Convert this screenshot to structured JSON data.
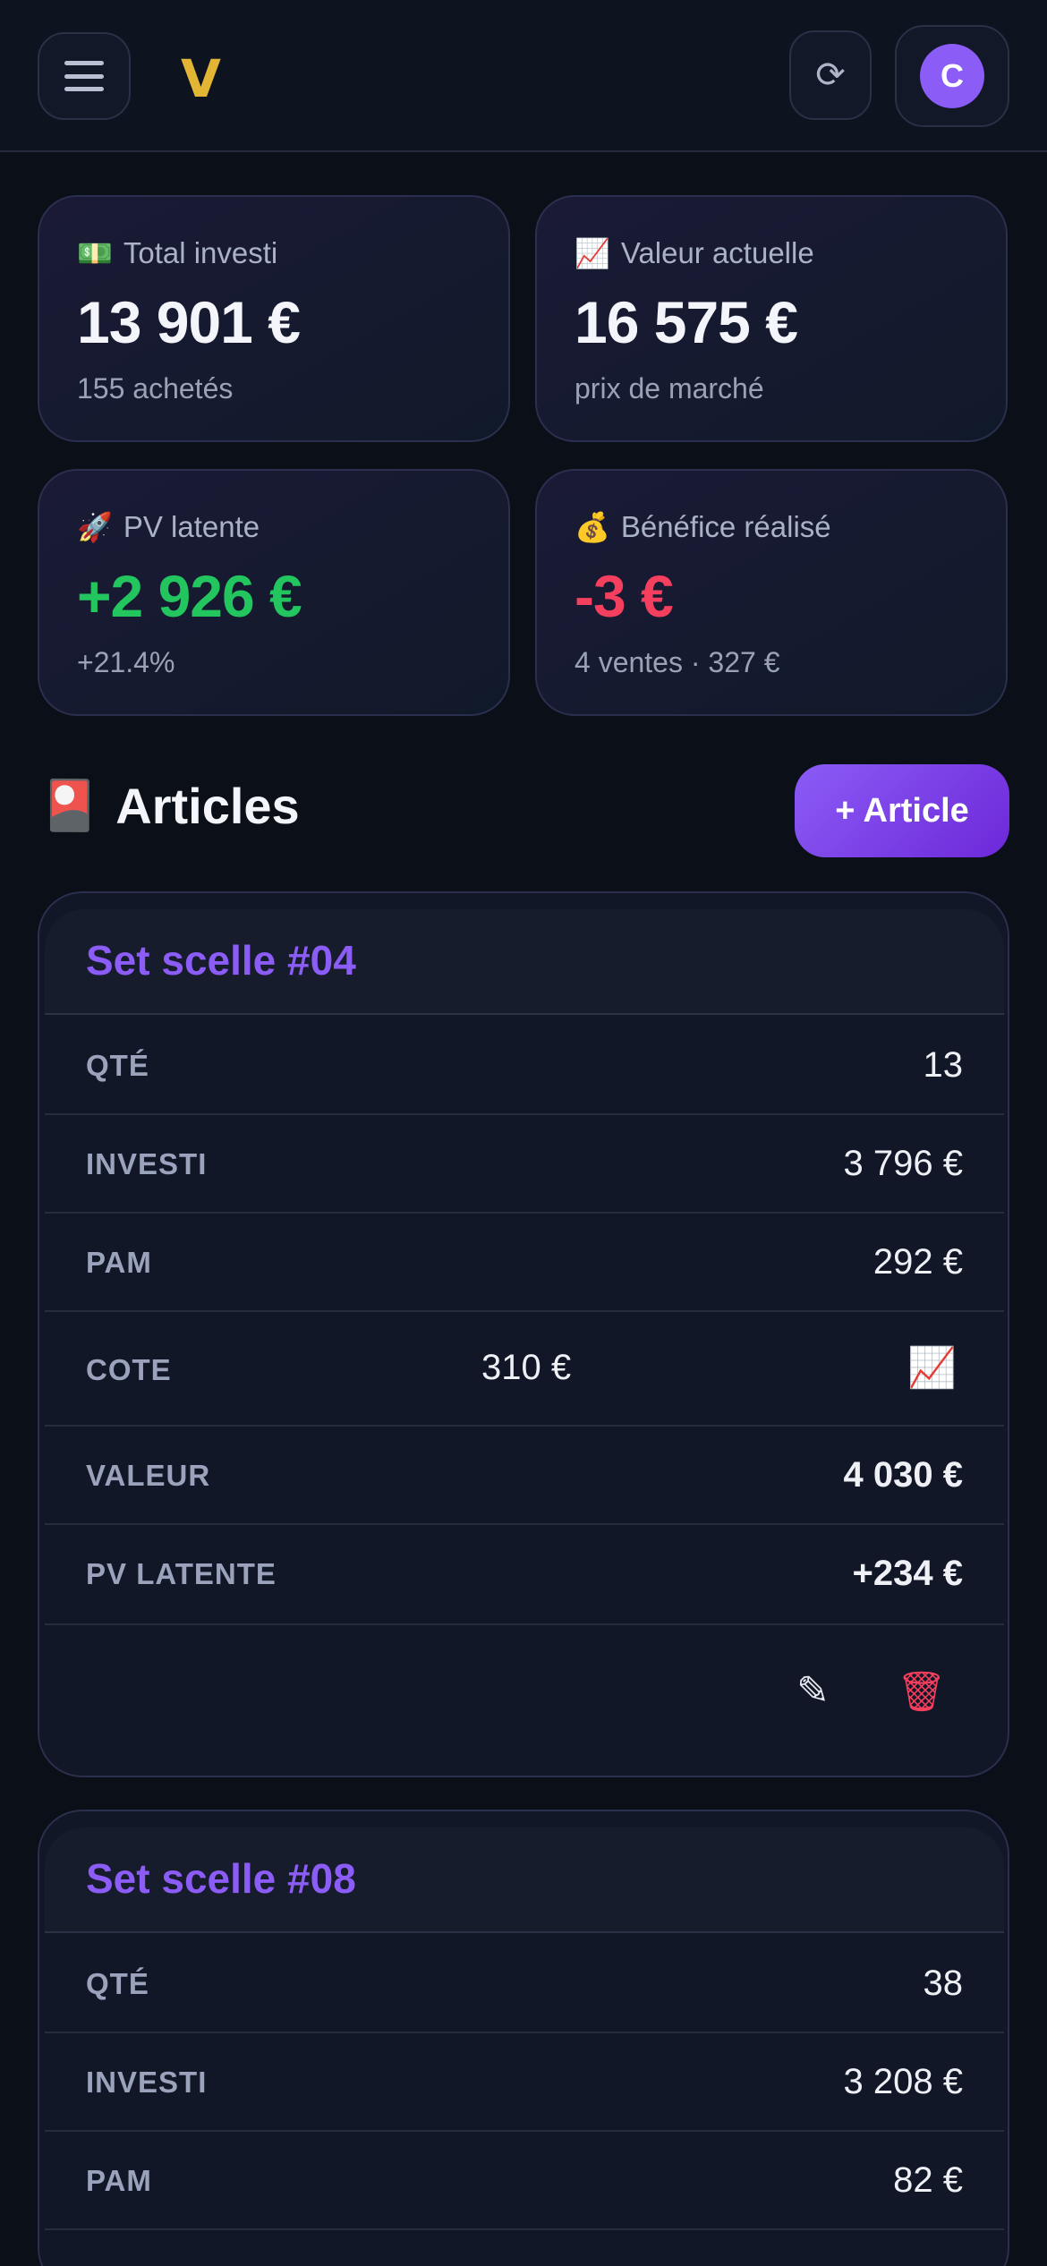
{
  "header": {
    "logo": "V",
    "refresh_icon": "⟳",
    "avatar_initial": "C"
  },
  "stats": [
    {
      "emoji": "💵",
      "label": "Total investi",
      "value": "13 901 €",
      "sub": "155 achetés"
    },
    {
      "emoji": "📈",
      "label": "Valeur actuelle",
      "value": "16 575 €",
      "sub": "prix de marché"
    },
    {
      "emoji": "🚀",
      "label": "PV latente",
      "value": "+2 926 €",
      "sub": "+21.4%",
      "tone": "positive"
    },
    {
      "emoji": "💰",
      "label": "Bénéfice réalisé",
      "value": "-3 €",
      "sub": "4 ventes · 327 €",
      "tone": "negative"
    }
  ],
  "section": {
    "emoji": "🎴",
    "title": "Articles",
    "add_button": "+ Article"
  },
  "articles": [
    {
      "title": "Set scelle #04",
      "qte_label": "QTÉ",
      "qte": "13",
      "investi_label": "INVESTI",
      "investi": "3 796 €",
      "pam_label": "PAM",
      "pam": "292 €",
      "cote_label": "COTE",
      "cote": "310 €",
      "valeur_label": "VALEUR",
      "valeur": "4 030 €",
      "pv_label": "PV LATENTE",
      "pv": "+234 €"
    },
    {
      "title": "Set scelle #08",
      "qte_label": "QTÉ",
      "qte": "38",
      "investi_label": "INVESTI",
      "investi": "3 208 €",
      "pam_label": "PAM",
      "pam": "82 €"
    }
  ],
  "icons": {
    "chart": "📈",
    "edit": "✎",
    "trash": "🗑"
  },
  "colors": {
    "accent": "#8b5cf6",
    "positive": "#22c55e",
    "negative": "#f43f5e",
    "logo": "#e2b534"
  }
}
